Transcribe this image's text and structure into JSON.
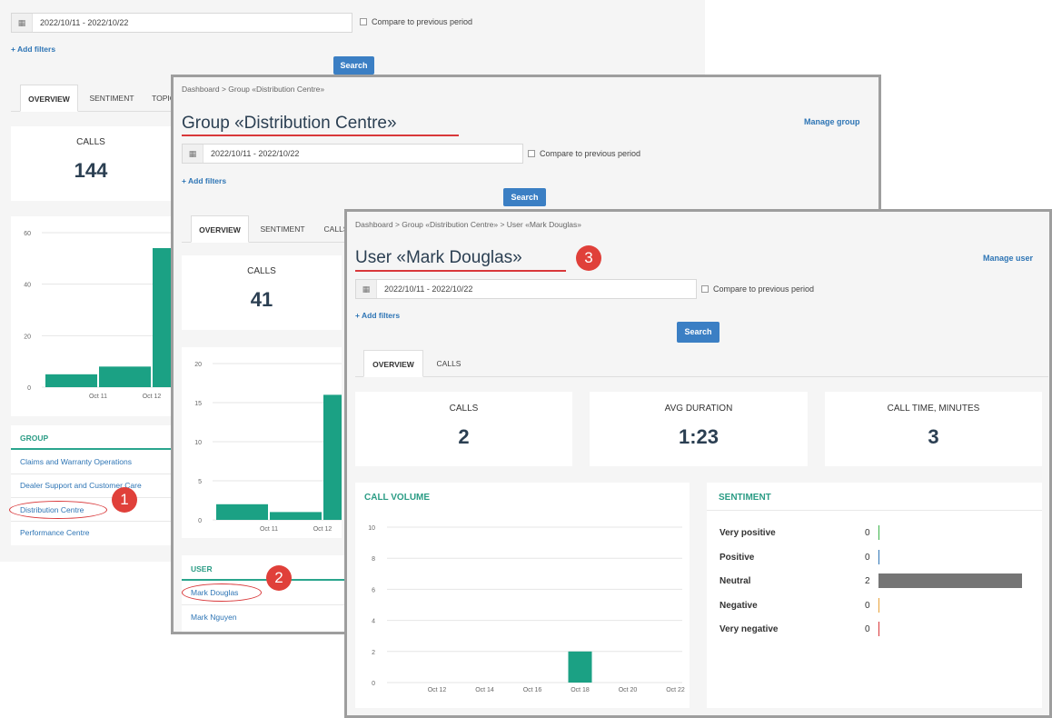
{
  "colors": {
    "teal": "#1ba184",
    "link": "#2e75b5",
    "search": "#3b7fc4",
    "annotation": "#e0403a",
    "neutral_bar": "#757575"
  },
  "shared": {
    "date_range": "2022/10/11 - 2022/10/22",
    "compare_label": "Compare to previous period",
    "add_filters": "+ Add filters",
    "search_label": "Search",
    "calendar_icon": "calendar-icon"
  },
  "panel1": {
    "tabs": [
      "OVERVIEW",
      "SENTIMENT",
      "TOPIC"
    ],
    "calls_label": "CALLS",
    "calls_value": "144",
    "group_header": "GROUP",
    "groups": [
      "Claims and Warranty Operations",
      "Dealer Support and Customer Care",
      "Distribution Centre",
      "Performance Centre"
    ],
    "badge": "1",
    "chart_data": {
      "type": "bar",
      "y_ticks": [
        "60",
        "40",
        "20",
        "0"
      ],
      "x_labels": [
        "Oct 11",
        "Oct 12"
      ],
      "ylim": [
        0,
        60
      ],
      "values": [
        5,
        8,
        54
      ]
    }
  },
  "panel2": {
    "breadcrumb": "Dashboard >  Group «Distribution Centre»",
    "title": "Group «Distribution Centre»",
    "manage": "Manage group",
    "tabs": [
      "OVERVIEW",
      "SENTIMENT",
      "CALLS"
    ],
    "calls_label": "CALLS",
    "calls_value": "41",
    "user_header": "USER",
    "users": [
      "Mark Douglas",
      "Mark Nguyen"
    ],
    "badge": "2",
    "chart_data": {
      "type": "bar",
      "y_ticks": [
        "20",
        "15",
        "10",
        "5",
        "0"
      ],
      "x_labels": [
        "Oct 11",
        "Oct 12"
      ],
      "ylim": [
        0,
        20
      ],
      "values": [
        2,
        1,
        16
      ]
    }
  },
  "panel3": {
    "breadcrumb": "Dashboard >  Group «Distribution Centre» >  User «Mark Douglas»",
    "title": "User «Mark Douglas»",
    "manage": "Manage user",
    "badge": "3",
    "tabs": [
      "OVERVIEW",
      "CALLS"
    ],
    "stats": [
      {
        "label": "CALLS",
        "value": "2"
      },
      {
        "label": "AVG DURATION",
        "value": "1:23"
      },
      {
        "label": "CALL TIME, MINUTES",
        "value": "3"
      }
    ],
    "call_volume_title": "CALL VOLUME",
    "sentiment_title": "SENTIMENT",
    "chart_data": {
      "type": "bar",
      "x": [
        "Oct 12",
        "Oct 14",
        "Oct 16",
        "Oct 18",
        "Oct 20",
        "Oct 22"
      ],
      "y_ticks": [
        "10",
        "8",
        "6",
        "4",
        "2",
        "0"
      ],
      "ylim": [
        0,
        10
      ],
      "bars": [
        {
          "x": "Oct 18",
          "value": 2
        }
      ]
    },
    "sentiment": [
      {
        "label": "Very positive",
        "value": "0",
        "count": 0,
        "color": "#3cb44b"
      },
      {
        "label": "Positive",
        "value": "0",
        "count": 0,
        "color": "#2e75b5"
      },
      {
        "label": "Neutral",
        "value": "2",
        "count": 2,
        "color": "#757575"
      },
      {
        "label": "Negative",
        "value": "0",
        "count": 0,
        "color": "#e8a23a"
      },
      {
        "label": "Very negative",
        "value": "0",
        "count": 0,
        "color": "#d9383a"
      }
    ]
  }
}
